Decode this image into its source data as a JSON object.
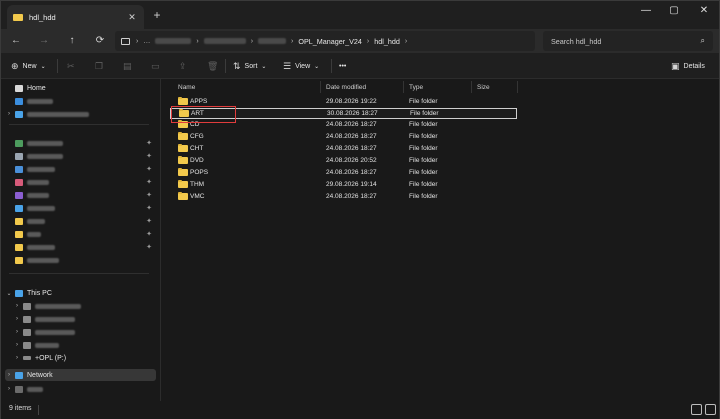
{
  "tab": {
    "title": "hdl_hdd"
  },
  "window_controls": {
    "minimize": "—",
    "maximize": "▢",
    "close": "✕"
  },
  "nav": {
    "back": "←",
    "forward": "→",
    "up": "↑",
    "refresh": "⟳"
  },
  "address": {
    "crumbs": [
      {
        "label": "OPL_Manager_V24"
      },
      {
        "label": "hdl_hdd"
      }
    ]
  },
  "search": {
    "placeholder": "Search hdl_hdd"
  },
  "toolbar": {
    "new_label": "New",
    "sort_label": "Sort",
    "view_label": "View",
    "more_label": "•••",
    "details_label": "Details"
  },
  "sidebar": {
    "home": "Home",
    "this_pc": "This PC",
    "opl_drive": "+OPL (P:)",
    "network": "Network"
  },
  "columns": {
    "name": "Name",
    "date": "Date modified",
    "type": "Type",
    "size": "Size"
  },
  "files": [
    {
      "name": "APPS",
      "date": "29.08.2026 19:22",
      "type": "File folder"
    },
    {
      "name": "ART",
      "date": "30.08.2026 18:27",
      "type": "File folder"
    },
    {
      "name": "CD",
      "date": "24.08.2026 18:27",
      "type": "File folder"
    },
    {
      "name": "CFG",
      "date": "24.08.2026 18:27",
      "type": "File folder"
    },
    {
      "name": "CHT",
      "date": "24.08.2026 18:27",
      "type": "File folder"
    },
    {
      "name": "DVD",
      "date": "24.08.2026 20:52",
      "type": "File folder"
    },
    {
      "name": "POPS",
      "date": "24.08.2026 18:27",
      "type": "File folder"
    },
    {
      "name": "THM",
      "date": "29.08.2026 19:14",
      "type": "File folder"
    },
    {
      "name": "VMC",
      "date": "24.08.2026 18:27",
      "type": "File folder"
    }
  ],
  "status": {
    "item_count": "9 items"
  },
  "colors": {
    "folder": "#f2c94c",
    "highlight": "#e03c3c",
    "background": "#191919"
  }
}
